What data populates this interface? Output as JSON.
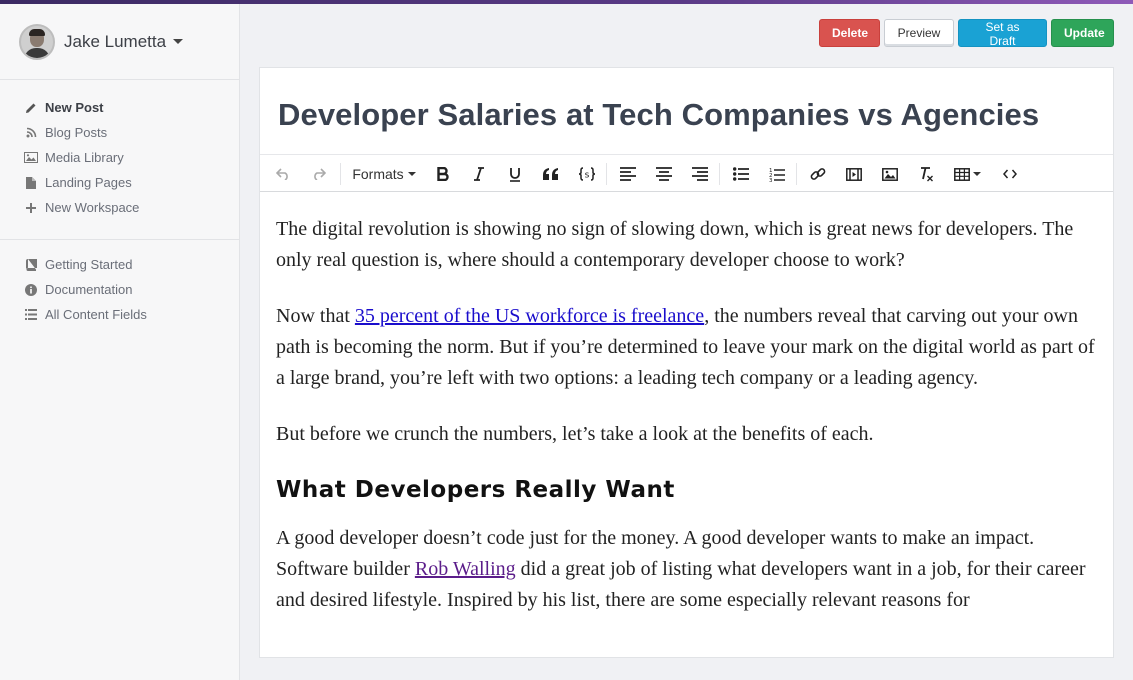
{
  "user": {
    "name": "Jake Lumetta"
  },
  "sidebar": {
    "primary": [
      {
        "label": "New Post",
        "icon": "pencil-icon",
        "active": true
      },
      {
        "label": "Blog Posts",
        "icon": "rss-icon"
      },
      {
        "label": "Media Library",
        "icon": "image-icon"
      },
      {
        "label": "Landing Pages",
        "icon": "file-icon"
      },
      {
        "label": "New Workspace",
        "icon": "plus-icon"
      }
    ],
    "secondary": [
      {
        "label": "Getting Started",
        "icon": "book-icon"
      },
      {
        "label": "Documentation",
        "icon": "info-icon"
      },
      {
        "label": "All Content Fields",
        "icon": "list-icon"
      }
    ]
  },
  "actions": {
    "delete": "Delete",
    "preview": "Preview",
    "draft": "Set as Draft",
    "update": "Update"
  },
  "colors": {
    "delete": "#d9534f",
    "draft": "#1aa2d4",
    "update": "#2ea55a",
    "link": "#1a0dcc",
    "visited_link": "#5b1d8a"
  },
  "editor": {
    "title": "Developer Salaries at Tech Companies vs Agencies",
    "toolbar": {
      "formats": "Formats"
    },
    "p1": "The digital revolution is showing no sign of slowing down, which is great news for developers. The only real question is, where should a contemporary developer choose to work?",
    "p2_prefix": "Now that ",
    "p2_link": "35 percent of the US workforce is freelance",
    "p2_suffix": ", the numbers reveal that carving out your own path is becoming the norm. But if you’re determined to leave your mark on the digital world as part of a large brand, you’re left with two options: a leading tech company or a leading agency.",
    "p3": "But before we crunch the numbers, let’s take a look at the benefits of each.",
    "h2": "What Developers Really Want",
    "p4_prefix": "A good developer doesn’t code just for the money. A good developer wants to make an impact. Software builder ",
    "p4_link": "Rob Walling",
    "p4_suffix": " did a great job of listing what developers want in a job, for their career and desired lifestyle. Inspired by his list, there are some especially relevant reasons for"
  }
}
